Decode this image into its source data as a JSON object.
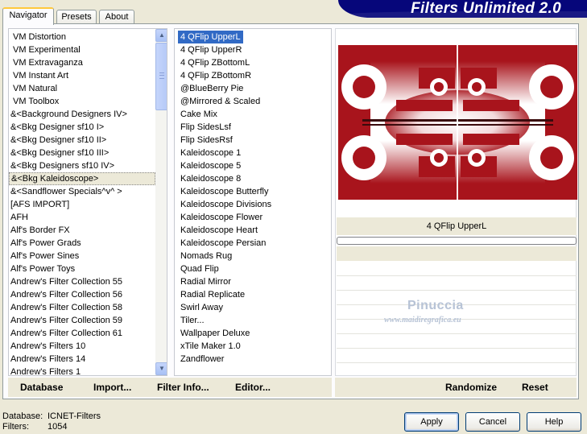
{
  "app": {
    "title": "Filters Unlimited 2.0"
  },
  "tabs": [
    {
      "label": "Navigator",
      "active": true
    },
    {
      "label": "Presets",
      "active": false
    },
    {
      "label": "About",
      "active": false
    }
  ],
  "categories": {
    "items": [
      "VM Distortion",
      "VM Experimental",
      "VM Extravaganza",
      "VM Instant Art",
      "VM Natural",
      "VM Toolbox",
      "&<Background Designers IV>",
      "&<Bkg Designer sf10 I>",
      "&<Bkg Designer sf10 II>",
      "&<Bkg Designer sf10 III>",
      "&<Bkg Designers sf10 IV>",
      "&<Bkg Kaleidoscope>",
      "&<Sandflower Specials^v^ >",
      "[AFS IMPORT]",
      "AFH",
      "Alf's Border FX",
      "Alf's Power Grads",
      "Alf's Power Sines",
      "Alf's Power Toys",
      "Andrew's Filter Collection 55",
      "Andrew's Filter Collection 56",
      "Andrew's Filter Collection 58",
      "Andrew's Filter Collection 59",
      "Andrew's Filter Collection 61",
      "Andrew's Filters 10",
      "Andrew's Filters 14",
      "Andrew's Filters 1"
    ],
    "selected": "&<Bkg Kaleidoscope>"
  },
  "filters": {
    "items": [
      "4 QFlip UpperL",
      "4 QFlip UpperR",
      "4 QFlip ZBottomL",
      "4 QFlip ZBottomR",
      "@BlueBerry Pie",
      "@Mirrored & Scaled",
      "Cake Mix",
      "Flip SidesLsf",
      "Flip SidesRsf",
      "Kaleidoscope 1",
      "Kaleidoscope 5",
      "Kaleidoscope 8",
      "Kaleidoscope Butterfly",
      "Kaleidoscope Divisions",
      "Kaleidoscope Flower",
      "Kaleidoscope Heart",
      "Kaleidoscope Persian",
      "Nomads Rug",
      "Quad Flip",
      "Radial Mirror",
      "Radial Replicate",
      "Swirl Away",
      "Tiler...",
      "Wallpaper Deluxe",
      "xTile Maker 1.0",
      "Zandflower"
    ],
    "selected": "4 QFlip UpperL"
  },
  "preview": {
    "filter_name": "4 QFlip UpperL",
    "colors": {
      "dark_red": "#a8141c",
      "light": "#ffffff",
      "mid": "#d77a80"
    }
  },
  "watermark": {
    "name": "Pinuccia",
    "url": "www.maidiregrafica.eu"
  },
  "bottom_left_buttons": {
    "database": "Database",
    "import": "Import...",
    "filter_info": "Filter Info...",
    "editor": "Editor..."
  },
  "bottom_right_buttons": {
    "randomize": "Randomize",
    "reset": "Reset"
  },
  "footer": {
    "database_label": "Database:",
    "database_value": "ICNET-Filters",
    "filters_label": "Filters:",
    "filters_value": "1054"
  },
  "dialog_buttons": {
    "apply": "Apply",
    "cancel": "Cancel",
    "help": "Help"
  },
  "colors": {
    "banner": "#06067a",
    "selection": "#316ac5",
    "panel_bg": "#ece9d8"
  }
}
